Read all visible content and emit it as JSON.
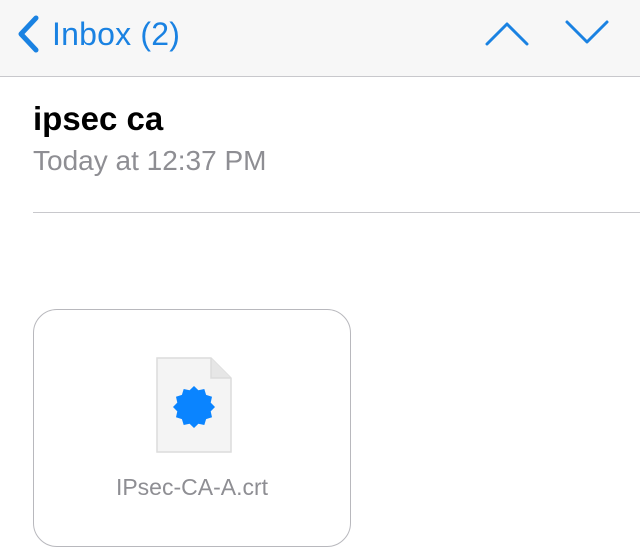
{
  "nav": {
    "back_label": "Inbox (2)",
    "accent_color": "#1a82e2",
    "back_icon": "chevron-left-icon",
    "previous_icon": "chevron-up-icon",
    "next_icon": "chevron-down-icon"
  },
  "message": {
    "subject": "ipsec ca",
    "timestamp": "Today at 12:37 PM"
  },
  "attachment": {
    "file_name": "IPsec-CA-A.crt",
    "icon": "certificate-file-icon",
    "badge_color": "#0a84ff"
  }
}
